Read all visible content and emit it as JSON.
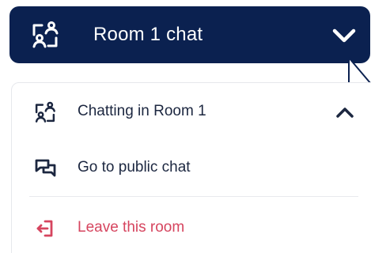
{
  "header": {
    "title": "Room 1 chat",
    "icon": "chat-room-icon",
    "toggle_icon": "chevron-down-icon"
  },
  "menu": {
    "items": [
      {
        "label": "Chatting in Room 1",
        "icon": "chat-room-icon",
        "trailing_icon": "chevron-up-icon"
      },
      {
        "label": "Go to public chat",
        "icon": "chat-bubbles-icon"
      },
      {
        "label": "Leave this room",
        "icon": "exit-icon"
      }
    ]
  },
  "colors": {
    "header_bg": "#0b2150",
    "text_primary": "#1c2740",
    "danger": "#d6455f",
    "divider": "#e8eaee"
  }
}
